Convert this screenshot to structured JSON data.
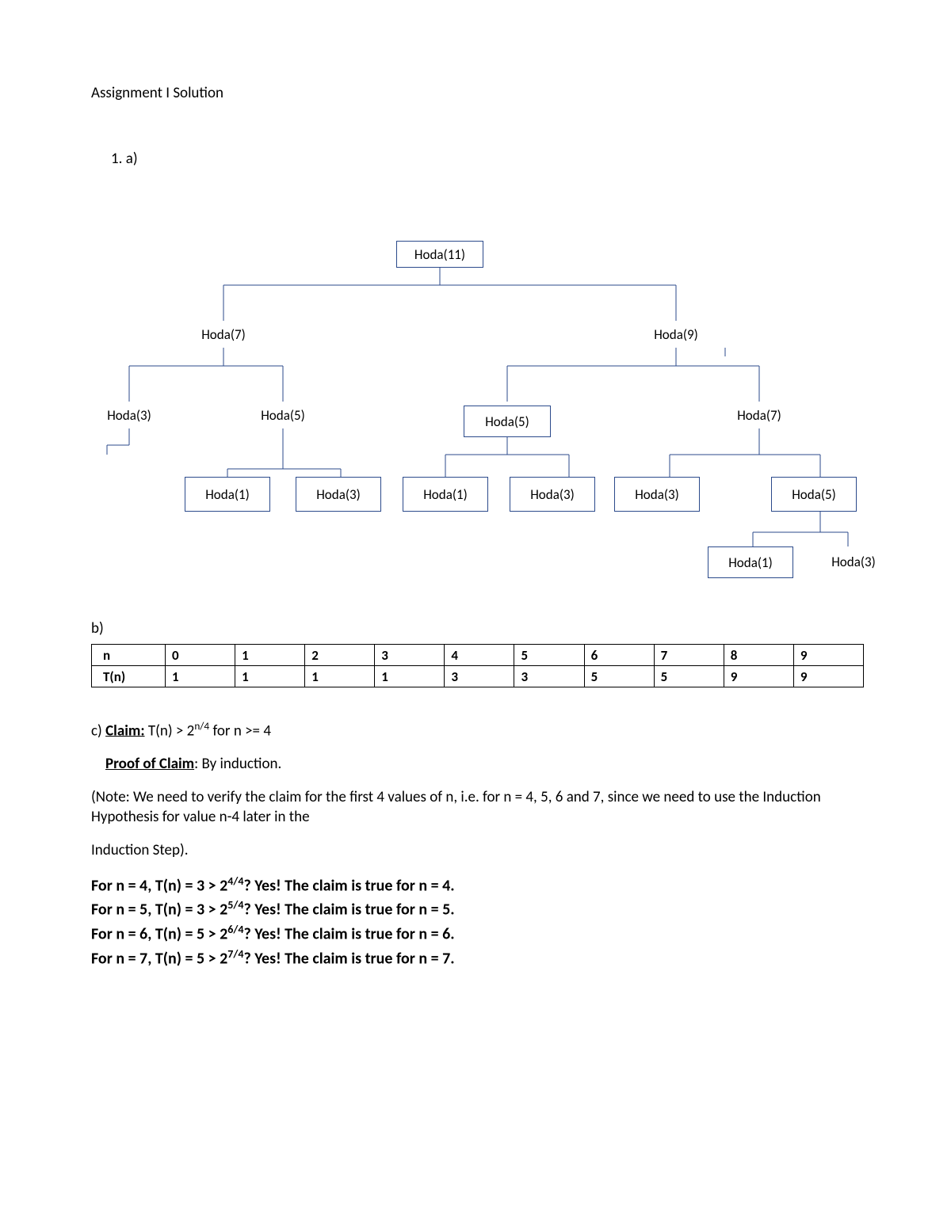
{
  "title": "Assignment I Solution",
  "q1_label": "1.   a)",
  "tree": {
    "root": "Hoda(11)",
    "l": "Hoda(7)",
    "r": "Hoda(9)",
    "ll": "Hoda(3)",
    "lr": "Hoda(5)",
    "rl": "Hoda(5)",
    "rr": "Hoda(7)",
    "lrl": "Hoda(1)",
    "lrr": "Hoda(3)",
    "rll": "Hoda(1)",
    "rlr": "Hoda(3)",
    "rrl": "Hoda(3)",
    "rrr": "Hoda(5)",
    "rrrl": "Hoda(1)",
    "rrrr": "Hoda(3)"
  },
  "part_b_label": "b)",
  "table": {
    "row1": [
      "n",
      "0",
      "1",
      "2",
      "3",
      "4",
      "5",
      "6",
      "7",
      "8",
      "9"
    ],
    "row2": [
      "T(n)",
      "1",
      "1",
      "1",
      "1",
      "3",
      "3",
      "5",
      "5",
      "9",
      "9"
    ]
  },
  "proof": {
    "c_prefix": "c) ",
    "claim_label": "Claim:",
    "claim_text_a": " T(n) > 2",
    "claim_sup": "n/4",
    "claim_text_b": " for n >= 4",
    "poc_label": "Proof of Claim",
    "poc_text": ": By induction.",
    "note": "(Note: We need to verify the claim for the first 4 values of n, i.e. for n = 4, 5, 6 and 7, since we need to use the Induction Hypothesis for value n-4 later in the",
    "note2": "Induction Step).",
    "lines": [
      {
        "a": "For n = 4, T(n) = 3 > 2",
        "sup": "4/4",
        "b": "? Yes! The claim is true for n = 4."
      },
      {
        "a": "For n = 5, T(n) = 3 > 2",
        "sup": "5/4",
        "b": "? Yes! The claim is true for n = 5."
      },
      {
        "a": "For n = 6, T(n) = 5 > 2",
        "sup": "6/4",
        "b": "? Yes! The claim is true for n = 6."
      },
      {
        "a": "For n = 7, T(n) = 5 > 2",
        "sup": "7/4",
        "b": "? Yes! The claim is true for n = 7."
      }
    ]
  },
  "chart_data": {
    "type": "table",
    "title": "T(n) values",
    "columns": [
      "n",
      "T(n)"
    ],
    "rows": [
      [
        0,
        1
      ],
      [
        1,
        1
      ],
      [
        2,
        1
      ],
      [
        3,
        1
      ],
      [
        4,
        3
      ],
      [
        5,
        3
      ],
      [
        6,
        5
      ],
      [
        7,
        5
      ],
      [
        8,
        9
      ],
      [
        9,
        9
      ]
    ]
  }
}
